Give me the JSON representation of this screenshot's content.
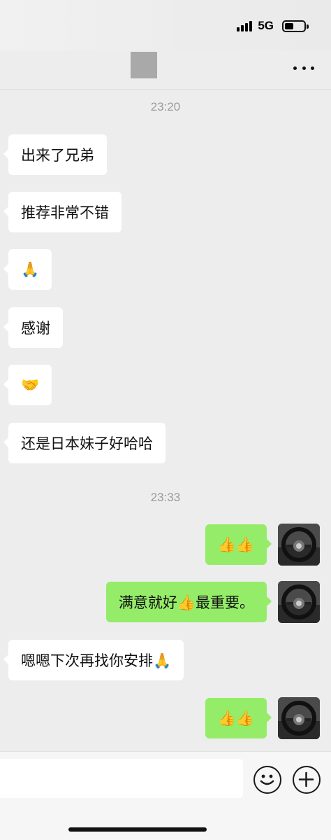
{
  "status_bar": {
    "network": "5G",
    "battery_level": 0.45,
    "signal_bars": 4
  },
  "header": {
    "avatar_color": "#a9a9a9",
    "more_icon": "more-dots-icon"
  },
  "messages": [
    {
      "type": "timestamp",
      "text": "23:20"
    },
    {
      "type": "incoming",
      "text": "出来了兄弟"
    },
    {
      "type": "incoming",
      "text": "推荐非常不错"
    },
    {
      "type": "incoming",
      "text": "🙏"
    },
    {
      "type": "incoming",
      "text": "感谢"
    },
    {
      "type": "incoming",
      "text": "🤝"
    },
    {
      "type": "incoming",
      "text": "还是日本妹子好哈哈"
    },
    {
      "type": "timestamp",
      "text": "23:33"
    },
    {
      "type": "outgoing",
      "text": "👍👍"
    },
    {
      "type": "outgoing",
      "text": "满意就好👍最重要。"
    },
    {
      "type": "incoming",
      "text": "嗯嗯下次再找你安排🙏"
    },
    {
      "type": "outgoing",
      "text": "👍👍"
    }
  ],
  "input_bar": {
    "placeholder": "",
    "emoji_icon": "emoji-smile-icon",
    "plus_icon": "plus-circle-icon"
  },
  "colors": {
    "background": "#ededed",
    "incoming_bubble": "#ffffff",
    "outgoing_bubble": "#95ec69",
    "timestamp_text": "#9b9b9b"
  }
}
